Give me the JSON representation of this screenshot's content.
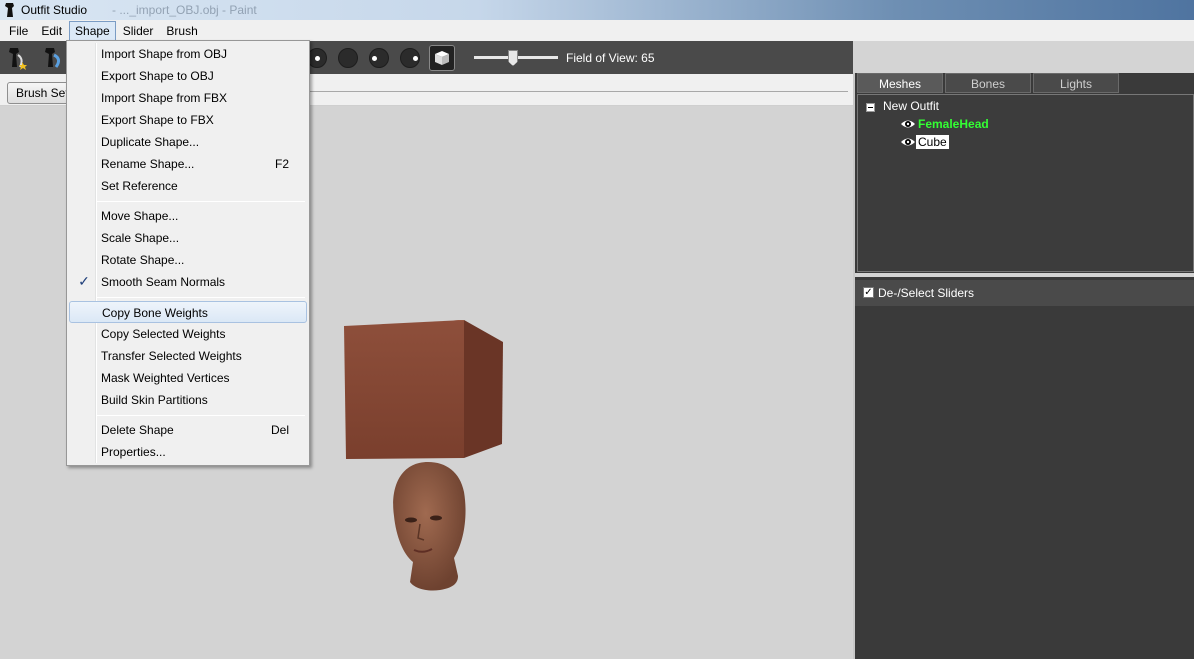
{
  "window": {
    "title": "Outfit Studio",
    "title_extra": "- ..._import_OBJ.obj - Paint"
  },
  "menubar": {
    "items": [
      "File",
      "Edit",
      "Shape",
      "Slider",
      "Brush"
    ],
    "active": "Shape"
  },
  "toolbar": {
    "fov_label": "Field of View: 65",
    "fov_value": 65
  },
  "brushbar": {
    "brush_settings_label": "Brush Settings"
  },
  "shape_menu": {
    "items": [
      {
        "label": "Import Shape from OBJ",
        "accel": ""
      },
      {
        "label": "Export Shape to OBJ",
        "accel": ""
      },
      {
        "label": "Import Shape from FBX",
        "accel": ""
      },
      {
        "label": "Export Shape to FBX",
        "accel": ""
      },
      {
        "label": "Duplicate Shape...",
        "accel": ""
      },
      {
        "label": "Rename Shape...",
        "accel": "F2"
      },
      {
        "label": "Set Reference",
        "accel": ""
      },
      {
        "label": "Move Shape...",
        "accel": ""
      },
      {
        "label": "Scale Shape...",
        "accel": ""
      },
      {
        "label": "Rotate Shape...",
        "accel": ""
      },
      {
        "label": "Smooth Seam Normals",
        "accel": "",
        "checked": true
      },
      {
        "label": "Copy Bone Weights",
        "accel": "",
        "highlighted": true
      },
      {
        "label": "Copy Selected Weights",
        "accel": ""
      },
      {
        "label": "Transfer Selected Weights",
        "accel": ""
      },
      {
        "label": "Mask Weighted Vertices",
        "accel": ""
      },
      {
        "label": "Build Skin Partitions",
        "accel": ""
      },
      {
        "label": "Delete Shape",
        "accel": "Del"
      },
      {
        "label": "Properties...",
        "accel": ""
      }
    ],
    "check_glyph": "✓"
  },
  "right_panel": {
    "tabs": [
      "Meshes",
      "Bones",
      "Lights"
    ],
    "active_tab": "Meshes",
    "tree": {
      "root": "New Outfit",
      "meshes": [
        {
          "name": "FemaleHead",
          "style": "green"
        },
        {
          "name": "Cube",
          "style": "selected"
        }
      ]
    },
    "sliders_header": {
      "label": "De-/Select Sliders",
      "checked": true
    }
  },
  "colors": {
    "toolbar_bg": "#4a4a4a",
    "panel_bg": "#3a3a3a",
    "viewport_bg": "#d3d3d3",
    "cube_front": "#8a4a36",
    "cube_top": "#a0604a",
    "cube_side": "#6a3526",
    "head_skin": "#8c5a42",
    "highlight_green": "#33ff33"
  },
  "icons": [
    "app-icon",
    "brush-tool-icon",
    "smooth-brush-icon",
    "eye-icon",
    "cube-view-icon",
    "check-icon"
  ]
}
